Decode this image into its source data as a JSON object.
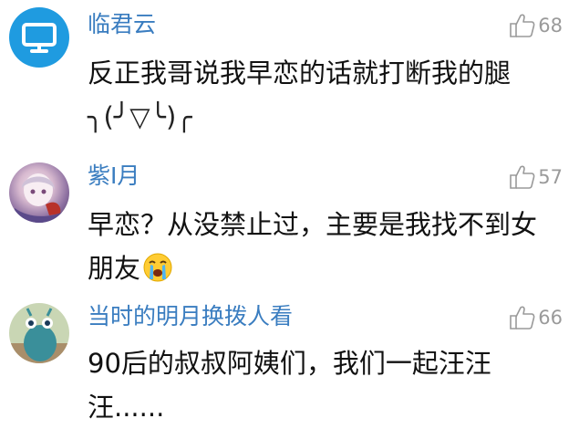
{
  "comments": [
    {
      "username": "临君云",
      "likes": "68",
      "text_line1": "反正我哥说我早恋的话就打断我的腿",
      "text_line2": "╮(╯▽╰)╭",
      "avatar_icon": "monitor-icon",
      "avatar_bg": "#1f9be0"
    },
    {
      "username": "紫I月",
      "likes": "57",
      "text_line1": "早恋？从没禁止过，主要是我找不到女",
      "text_line2": "朋友",
      "text_emoji": "crying-face-emoji"
    },
    {
      "username": "当时的明月换拨人看",
      "likes": "66",
      "text_line1": "90后的叔叔阿姨们，我们一起汪汪汪......"
    }
  ],
  "colors": {
    "username": "#3a7dc0",
    "like": "#9a9a9a",
    "text": "#111111"
  }
}
